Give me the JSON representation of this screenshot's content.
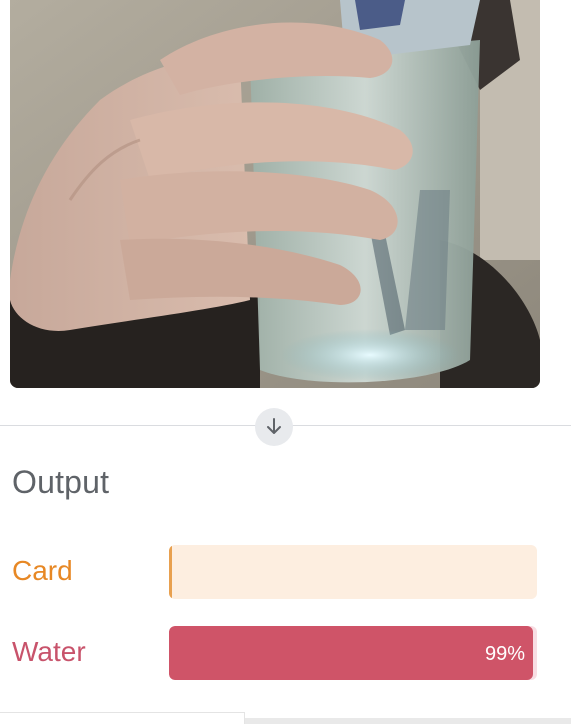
{
  "webcam": {
    "scene": "webcam-preview-hand-holding-water-bottle"
  },
  "divider": {
    "icon": "arrow-down-icon"
  },
  "output": {
    "title": "Output",
    "classes": [
      {
        "label": "Card",
        "confidence": 0.0,
        "percent_text": "",
        "color": "#e8a04f"
      },
      {
        "label": "Water",
        "confidence": 0.99,
        "percent_text": "99%",
        "color": "#cf5468"
      }
    ]
  }
}
